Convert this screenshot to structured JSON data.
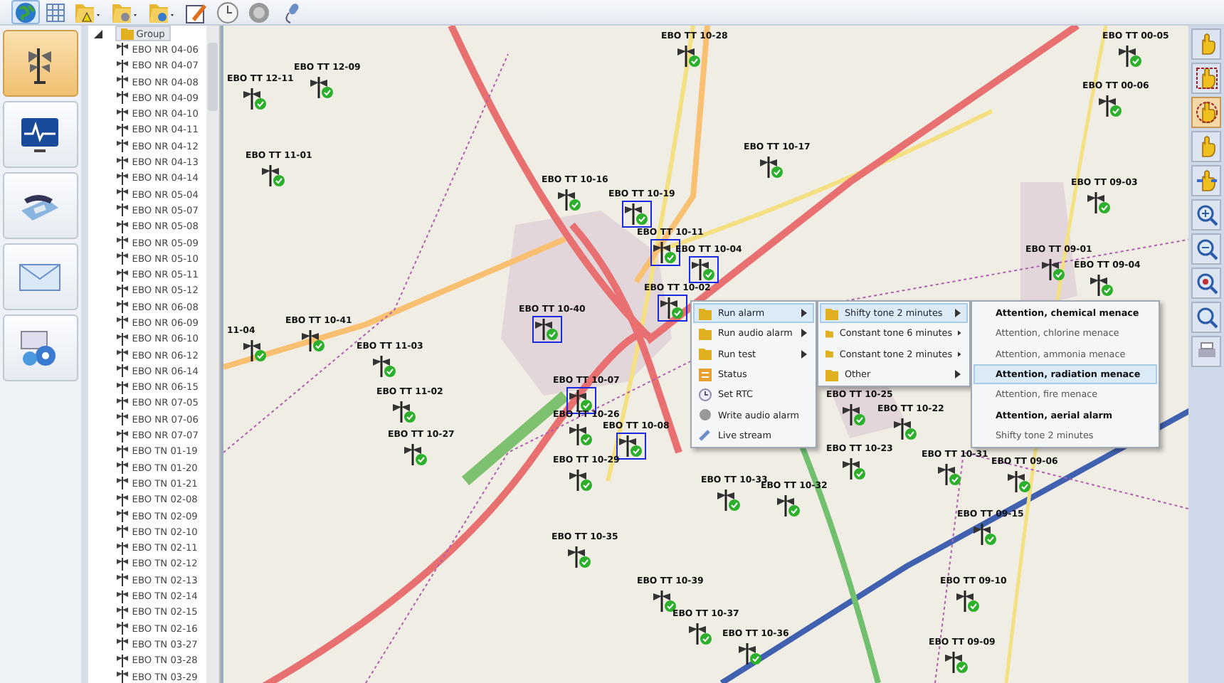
{
  "toolbar": [
    {
      "kind": "globe",
      "selected": true
    },
    {
      "kind": "grid",
      "selected": false
    },
    {
      "kind": "folder-warning",
      "selected": false
    },
    {
      "kind": "folder-disk",
      "selected": false
    },
    {
      "kind": "folder-down",
      "selected": false
    },
    {
      "kind": "edit",
      "selected": false
    },
    {
      "kind": "clock",
      "selected": false
    },
    {
      "kind": "speaker",
      "selected": false
    },
    {
      "kind": "microphone",
      "selected": false
    }
  ],
  "left_nav": [
    {
      "kind": "siren",
      "selected": true
    },
    {
      "kind": "monitor",
      "selected": false
    },
    {
      "kind": "phone",
      "selected": false
    },
    {
      "kind": "mail",
      "selected": false
    },
    {
      "kind": "settings",
      "selected": false
    }
  ],
  "tree": {
    "label": "Group",
    "expanded": true,
    "children": [
      "EBO NR 04-06",
      "EBO NR 04-07",
      "EBO NR 04-08",
      "EBO NR 04-09",
      "EBO NR 04-10",
      "EBO NR 04-11",
      "EBO NR 04-12",
      "EBO NR 04-13",
      "EBO NR 04-14",
      "EBO NR 05-04",
      "EBO NR 05-07",
      "EBO NR 05-08",
      "EBO NR 05-09",
      "EBO NR 05-10",
      "EBO NR 05-11",
      "EBO NR 05-12",
      "EBO NR 06-08",
      "EBO NR 06-09",
      "EBO NR 06-10",
      "EBO NR 06-12",
      "EBO NR 06-14",
      "EBO NR 06-15",
      "EBO NR 07-05",
      "EBO NR 07-06",
      "EBO NR 07-07",
      "EBO TN 01-19",
      "EBO TN 01-20",
      "EBO TN 01-21",
      "EBO TN 02-08",
      "EBO TN 02-09",
      "EBO TN 02-10",
      "EBO TN 02-11",
      "EBO TN 02-12",
      "EBO TN 02-13",
      "EBO TN 02-14",
      "EBO TN 02-15",
      "EBO TN 02-16",
      "EBO TN 03-27",
      "EBO TN 03-28",
      "EBO TN 03-29"
    ]
  },
  "map": {
    "markers": [
      {
        "label": "EBO TT 10-28",
        "selected": false
      },
      {
        "label": "EBO TT 12-11",
        "selected": false
      },
      {
        "label": "EBO TT 12-09",
        "selected": false
      },
      {
        "label": "EBO TT 00-05",
        "selected": false
      },
      {
        "label": "EBO TT 00-06",
        "selected": false
      },
      {
        "label": "EBO TT 11-01",
        "selected": false
      },
      {
        "label": "EBO TT 10-17",
        "selected": false
      },
      {
        "label": "EBO TT 10-16",
        "selected": false
      },
      {
        "label": "EBO TT 10-19",
        "selected": true
      },
      {
        "label": "EBO TT 10-11",
        "selected": true
      },
      {
        "label": "EBO TT 10-04",
        "selected": true
      },
      {
        "label": "EBO TT 09-03",
        "selected": false
      },
      {
        "label": "EBO TT 09-01",
        "selected": false
      },
      {
        "label": "EBO TT 10-02",
        "selected": true
      },
      {
        "label": "EBO TT 09-04",
        "selected": false
      },
      {
        "label": "EBO TT 10-40",
        "selected": true
      },
      {
        "label": "EBO TT 10-41",
        "selected": false
      },
      {
        "label": "11-04",
        "selected": false
      },
      {
        "label": "EBO TT 11-03",
        "selected": false
      },
      {
        "label": "EBO TT 11-02",
        "selected": false
      },
      {
        "label": "EBO TT 10-07",
        "selected": true
      },
      {
        "label": "EBO TT 10-26",
        "selected": false
      },
      {
        "label": "EBO TT 10-08",
        "selected": true
      },
      {
        "label": "EBO TT 10-27",
        "selected": false
      },
      {
        "label": "EBO TT 10-29",
        "selected": false
      },
      {
        "label": "EBO TT 10-25",
        "selected": false
      },
      {
        "label": "EBO TT 10-22",
        "selected": false
      },
      {
        "label": "EBO TT 10-31",
        "selected": false
      },
      {
        "label": "EBO TT 10-23",
        "selected": false
      },
      {
        "label": "EBO TT 10-33",
        "selected": false
      },
      {
        "label": "EBO TT 10-32",
        "selected": false
      },
      {
        "label": "EBO TT 09-06",
        "selected": false
      },
      {
        "label": "EBO TT 09-15",
        "selected": false
      },
      {
        "label": "EBO TT 10-35",
        "selected": false
      },
      {
        "label": "EBO TT 10-39",
        "selected": false
      },
      {
        "label": "EBO TT 10-37",
        "selected": false
      },
      {
        "label": "EBO TT 10-36",
        "selected": false
      },
      {
        "label": "EBO TT 09-10",
        "selected": false
      },
      {
        "label": "EBO TT 09-09",
        "selected": false
      }
    ]
  },
  "context_menu": {
    "items": [
      {
        "kind": "folder",
        "label": "Run alarm",
        "submenu": true,
        "selected": true
      },
      {
        "kind": "folder",
        "label": "Run audio alarm",
        "submenu": true,
        "selected": false
      },
      {
        "kind": "folder",
        "label": "Run test",
        "submenu": true,
        "selected": false
      },
      {
        "kind": "status",
        "label": "Status",
        "submenu": false,
        "selected": false
      },
      {
        "kind": "clock",
        "label": "Set RTC",
        "submenu": false,
        "selected": false
      },
      {
        "kind": "speaker",
        "label": "Write audio alarm",
        "submenu": false,
        "selected": false
      },
      {
        "kind": "microphone",
        "label": "Live stream",
        "submenu": false,
        "selected": false
      }
    ],
    "submenu": [
      {
        "label": "Shifty tone 2 minutes",
        "selected": true
      },
      {
        "label": "Constant tone 6 minutes",
        "selected": false
      },
      {
        "label": "Constant tone 2 minutes",
        "selected": false
      },
      {
        "label": "Other",
        "selected": false
      }
    ],
    "messages": [
      {
        "label": "Attention, chemical menace",
        "bold": true,
        "selected": false
      },
      {
        "label": "Attention, chlorine menace",
        "bold": false,
        "selected": false
      },
      {
        "label": "Attention, ammonia menace",
        "bold": false,
        "selected": false
      },
      {
        "label": "Attention, radiation menace",
        "bold": true,
        "selected": true
      },
      {
        "label": "Attention, fire menace",
        "bold": false,
        "selected": false
      },
      {
        "label": "Attention, aerial alarm",
        "bold": true,
        "selected": false
      },
      {
        "label": "Shifty tone 2 minutes",
        "bold": false,
        "selected": false
      }
    ]
  },
  "right_tools": [
    {
      "kind": "hand",
      "selected": false
    },
    {
      "kind": "hand-select",
      "selected": false
    },
    {
      "kind": "hand-circle",
      "selected": true
    },
    {
      "kind": "hand-rect",
      "selected": false
    },
    {
      "kind": "hand-move",
      "selected": false
    },
    {
      "kind": "zoom-in",
      "selected": false
    },
    {
      "kind": "zoom-out",
      "selected": false
    },
    {
      "kind": "zoom-area",
      "selected": false
    },
    {
      "kind": "zoom-fit",
      "selected": false
    },
    {
      "kind": "print",
      "selected": false
    }
  ]
}
